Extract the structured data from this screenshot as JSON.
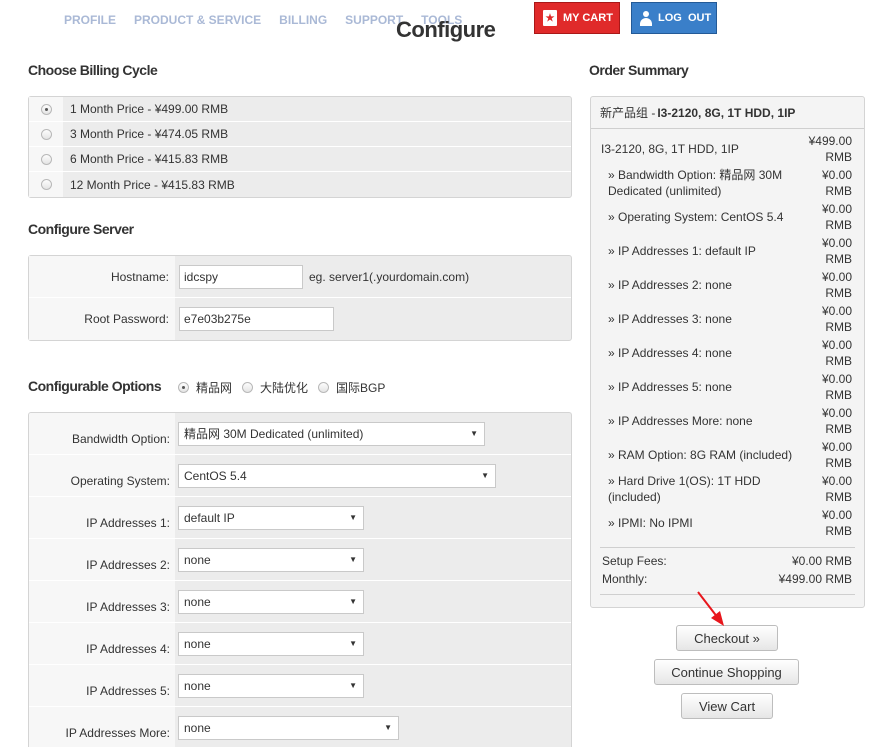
{
  "nav": {
    "items": [
      "PROFILE",
      "PRODUCT & SERVICE",
      "BILLING",
      "SUPPORT",
      "TOOLS"
    ],
    "title": "Configure",
    "cart_label": "MY CART",
    "logout_label": "LOG  OUT"
  },
  "billing": {
    "heading": "Choose Billing Cycle",
    "options": [
      {
        "label": "1 Month Price - ¥499.00 RMB",
        "selected": true
      },
      {
        "label": "3 Month Price - ¥474.05 RMB",
        "selected": false
      },
      {
        "label": "6 Month Price - ¥415.83 RMB",
        "selected": false
      },
      {
        "label": "12 Month Price - ¥415.83 RMB",
        "selected": false
      }
    ]
  },
  "server": {
    "heading": "Configure Server",
    "hostname_label": "Hostname:",
    "hostname_value": "idcspy",
    "hostname_hint": "eg. server1(.yourdomain.com)",
    "password_label": "Root Password:",
    "password_value": "e7e03b275e"
  },
  "options": {
    "heading": "Configurable Options",
    "network_choices": [
      "精品网",
      "大陆优化",
      "国际BGP"
    ],
    "network_selected": "精品网",
    "rows": [
      {
        "label": "Bandwidth Option:",
        "value": "精品网 30M Dedicated (unlimited)"
      },
      {
        "label": "Operating System:",
        "value": "CentOS 5.4"
      },
      {
        "label": "IP Addresses 1:",
        "value": "default IP"
      },
      {
        "label": "IP Addresses 2:",
        "value": "none"
      },
      {
        "label": "IP Addresses 3:",
        "value": "none"
      },
      {
        "label": "IP Addresses 4:",
        "value": "none"
      },
      {
        "label": "IP Addresses 5:",
        "value": "none"
      },
      {
        "label": "IP Addresses More:",
        "value": "none"
      }
    ]
  },
  "summary": {
    "heading": "Order Summary",
    "group": "新产品组 -",
    "product": "I3-2120, 8G, 1T HDD, 1IP",
    "main_item": {
      "name": "I3-2120, 8G, 1T HDD, 1IP",
      "price": "¥499.00 RMB"
    },
    "items": [
      {
        "name": "» Bandwidth Option: 精品网 30M Dedicated (unlimited)",
        "price": "¥0.00 RMB"
      },
      {
        "name": "» Operating System: CentOS 5.4",
        "price": "¥0.00 RMB"
      },
      {
        "name": "» IP Addresses 1: default IP",
        "price": "¥0.00 RMB"
      },
      {
        "name": "» IP Addresses 2: none",
        "price": "¥0.00 RMB"
      },
      {
        "name": "» IP Addresses 3: none",
        "price": "¥0.00 RMB"
      },
      {
        "name": "» IP Addresses 4: none",
        "price": "¥0.00 RMB"
      },
      {
        "name": "» IP Addresses 5: none",
        "price": "¥0.00 RMB"
      },
      {
        "name": "» IP Addresses More: none",
        "price": "¥0.00 RMB"
      },
      {
        "name": "» RAM Option: 8G RAM (included)",
        "price": "¥0.00 RMB"
      },
      {
        "name": "» Hard Drive 1(OS): 1T HDD (included)",
        "price": "¥0.00 RMB"
      },
      {
        "name": "» IPMI: No IPMI",
        "price": "¥0.00 RMB"
      }
    ],
    "setup_label": "Setup Fees:",
    "setup_value": "¥0.00 RMB",
    "monthly_label": "Monthly:",
    "monthly_value": "¥499.00 RMB"
  },
  "buttons": {
    "checkout": "Checkout »",
    "continue": "Continue Shopping",
    "view_cart": "View Cart"
  },
  "colors": {
    "cart": "#e02a2a",
    "logout": "#3a7fc9",
    "annotation_arrow": "#e8161c"
  }
}
